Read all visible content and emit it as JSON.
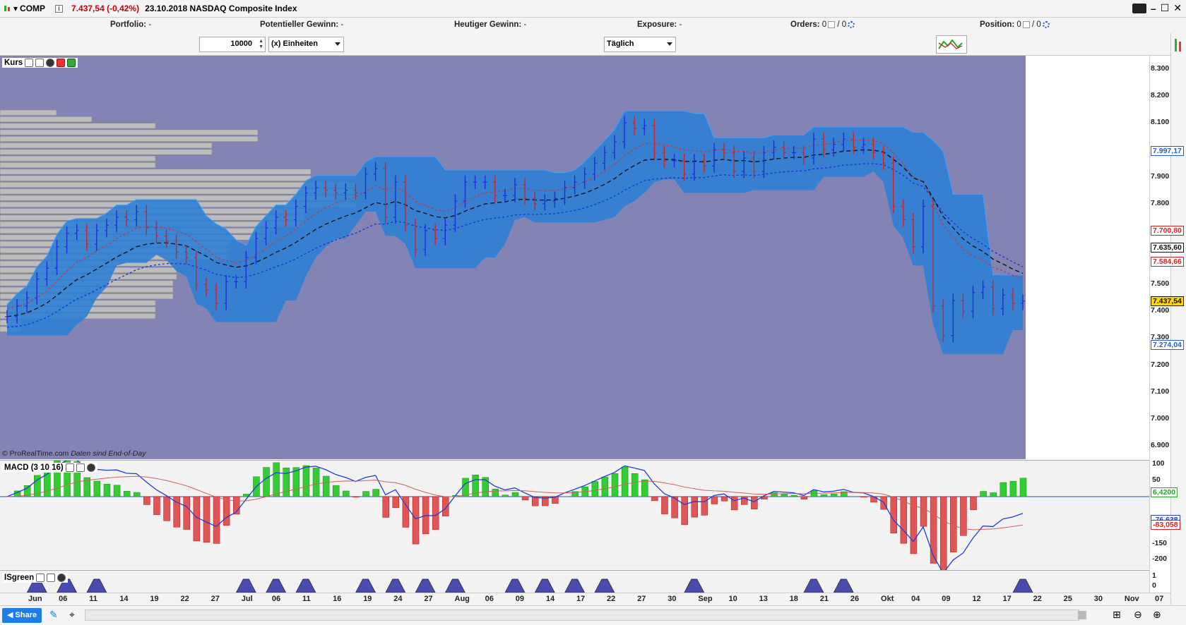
{
  "titlebar": {
    "symbol": "COMP",
    "price": "7.437,54 (-0,42%)",
    "date_title": "23.10.2018 NASDAQ Composite Index"
  },
  "portfolio": {
    "portfolio_label": "Portfolio:",
    "portfolio_value": "-",
    "pot_label": "Potentieller Gewinn:",
    "pot_value": "-",
    "today_label": "Heutiger Gewinn:",
    "today_value": "-",
    "exposure_label": "Exposure:",
    "exposure_value": "-",
    "orders_label": "Orders:",
    "orders_a": "0",
    "orders_b": "/ 0",
    "position_label": "Position:",
    "position_a": "0",
    "position_b": "/ 0"
  },
  "order": {
    "quantity": "10000",
    "unit": "(x) Einheiten",
    "period": "Täglich"
  },
  "price_panel": {
    "title": "Kurs",
    "copyright": "© ProRealTime.com",
    "eod": "Daten sind End-of-Day",
    "ticks": [
      "8.300",
      "8.200",
      "8.100",
      "7.900",
      "7.800",
      "7.500",
      "7.400",
      "7.300",
      "7.200",
      "7.100",
      "7.000",
      "6.900"
    ],
    "tags": [
      {
        "label": "7.997,17",
        "color": "#1f5fd6"
      },
      {
        "label": "7.700,80",
        "color": "#d82020"
      },
      {
        "label": "7.635,60",
        "color": "#111111"
      },
      {
        "label": "7.584,66",
        "color": "#d82020"
      },
      {
        "label": "7.437,54",
        "color": "#111111"
      },
      {
        "label": "7.274,04",
        "color": "#1f5fd6"
      }
    ]
  },
  "macd_panel": {
    "title": "MACD (3 10 16)",
    "ticks": [
      "100",
      "50",
      "-150",
      "-200"
    ],
    "tags": [
      {
        "label": "6,4200",
        "color": "#2aa02a"
      },
      {
        "label": "-76,638",
        "color": "#1f3fd6"
      },
      {
        "label": "-83,058",
        "color": "#d82020"
      }
    ]
  },
  "isgreen_panel": {
    "title": "ISgreen",
    "ticks": [
      "1",
      "0"
    ]
  },
  "date_axis": [
    "Jun",
    "06",
    "11",
    "14",
    "19",
    "22",
    "27",
    "Jul",
    "06",
    "11",
    "16",
    "19",
    "24",
    "27",
    "Aug",
    "06",
    "09",
    "14",
    "17",
    "22",
    "27",
    "30",
    "Sep",
    "10",
    "13",
    "18",
    "21",
    "26",
    "Okt",
    "04",
    "09",
    "12",
    "17",
    "22",
    "25",
    "30",
    "Nov",
    "07"
  ],
  "bottom": {
    "share": "Share"
  },
  "chart_data": {
    "type": "candlestick",
    "title": "23.10.2018 NASDAQ Composite Index",
    "symbol": "COMP",
    "timeframe": "Täglich",
    "ylim": [
      6850,
      8350
    ],
    "last": 7437.54,
    "indicators": {
      "upper_band_last": 7997.17,
      "ma_red_last": 7700.8,
      "ma_black_last": 7635.6,
      "ma_red2_last": 7584.66,
      "lower_band_last": 7274.04,
      "macd": {
        "params": [
          3,
          10,
          16
        ],
        "histogram_last": 6.42,
        "macd_last": -76.638,
        "signal_last": -83.058
      }
    },
    "closes_approx": [
      7380,
      7420,
      7450,
      7520,
      7560,
      7640,
      7690,
      7700,
      7650,
      7700,
      7720,
      7750,
      7740,
      7770,
      7710,
      7680,
      7660,
      7620,
      7600,
      7500,
      7480,
      7430,
      7510,
      7510,
      7600,
      7670,
      7710,
      7750,
      7740,
      7790,
      7840,
      7860,
      7850,
      7840,
      7850,
      7840,
      7910,
      7930,
      7750,
      7880,
      7720,
      7630,
      7700,
      7670,
      7720,
      7810,
      7880,
      7880,
      7880,
      7830,
      7830,
      7870,
      7820,
      7800,
      7810,
      7820,
      7860,
      7880,
      7910,
      7950,
      7990,
      8030,
      8100,
      8080,
      8090,
      7990,
      7960,
      7960,
      7910,
      7960,
      7940,
      8000,
      7990,
      7920,
      7970,
      7920,
      7990,
      8010,
      7990,
      7990,
      7970,
      8040,
      8000,
      8020,
      8040,
      8010,
      8020,
      7990,
      7950,
      7790,
      7740,
      7640,
      7790,
      7420,
      7310,
      7440,
      7400,
      7470,
      7490,
      7410,
      7460,
      7430,
      7438
    ]
  }
}
